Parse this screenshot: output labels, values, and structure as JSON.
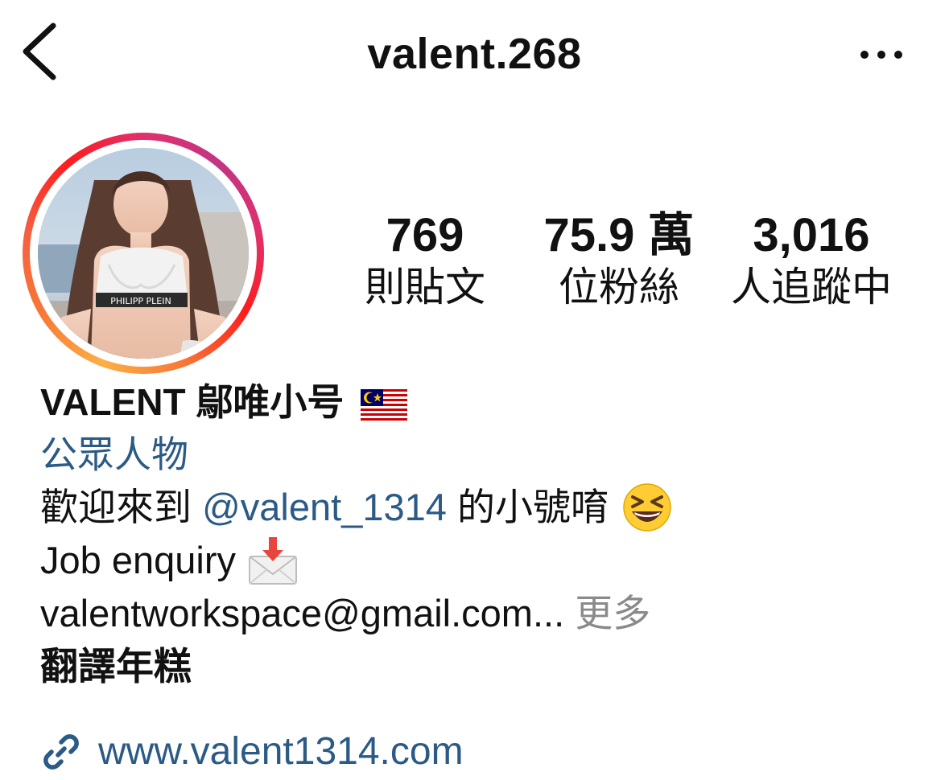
{
  "header": {
    "username": "valent.268"
  },
  "stats": {
    "posts": {
      "value": "769",
      "label": "則貼文"
    },
    "followers": {
      "value": "75.9 萬",
      "label": "位粉絲"
    },
    "following": {
      "value": "3,016",
      "label": "人追蹤中"
    }
  },
  "bio": {
    "name": "VALENT 鄔唯小号",
    "category": "公眾人物",
    "line1_prefix": "歡迎來到 ",
    "line1_mention": "@valent_1314",
    "line1_suffix": " 的小號唷",
    "line2": "Job enquiry",
    "line3_email": "valentworkspace@gmail.com",
    "line3_ellipsis": "...",
    "line3_more": " 更多",
    "translate": "翻譯年糕"
  },
  "link": {
    "url_text": "www.valent1314.com"
  },
  "icons": {
    "back": "chevron-left-icon",
    "more": "ellipsis-icon",
    "flag": "malaysia-flag-icon",
    "emoji": "grinning-squinting-face-icon",
    "inbox": "envelope-with-arrow-icon",
    "link": "link-icon"
  },
  "colors": {
    "link_blue": "#2b5a85",
    "muted_gray": "#8a8a8a"
  }
}
